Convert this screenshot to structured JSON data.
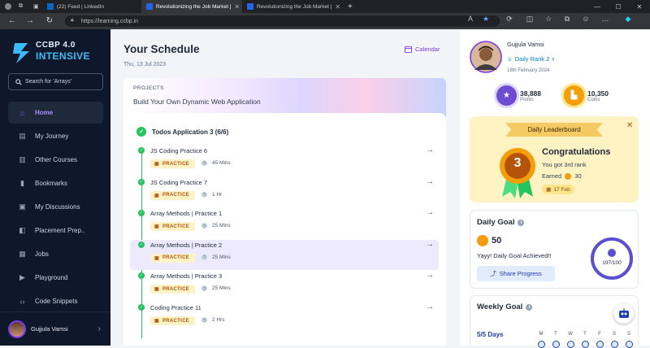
{
  "browser": {
    "tabs": [
      {
        "title": "(22) Feed | LinkedIn",
        "favicon_color": "#0a66c2"
      },
      {
        "title": "Revolutionizing the Job Market |",
        "favicon_color": "#2563eb"
      },
      {
        "title": "Revolutionizing the Job Market |",
        "favicon_color": "#2563eb"
      }
    ],
    "url": "https://learning.ccbp.in"
  },
  "sidebar": {
    "logo_line1": "CCBP 4.0",
    "logo_line2": "INTENSIVE",
    "search_placeholder": "Search for 'Arrays'",
    "items": [
      {
        "label": "Home",
        "icon": "home-icon",
        "active": true
      },
      {
        "label": "My Journey",
        "icon": "journey-icon"
      },
      {
        "label": "Other Courses",
        "icon": "book-icon"
      },
      {
        "label": "Bookmarks",
        "icon": "bookmark-icon"
      },
      {
        "label": "My Discussions",
        "icon": "discussion-icon"
      },
      {
        "label": "Placement Prep..",
        "icon": "placement-icon"
      },
      {
        "label": "Jobs",
        "icon": "briefcase-icon"
      },
      {
        "label": "Playground",
        "icon": "terminal-icon"
      },
      {
        "label": "Code Snippets",
        "icon": "code-icon"
      }
    ],
    "user_name": "Gujjula Vamsi"
  },
  "schedule": {
    "title": "Your Schedule",
    "date": "Thu, 13 Jul 2023",
    "calendar_label": "Calendar",
    "project_label": "PROJECTS",
    "project_title": "Build Your Own Dynamic Web Application",
    "todo_heading": "Todos Application 3 (6/6)",
    "badge_label": "PRACTICE",
    "tasks": [
      {
        "name": "JS Coding Practice 6",
        "duration": "45 Mins",
        "highlighted": false
      },
      {
        "name": "JS Coding Practice 7",
        "duration": "1 Hr",
        "highlighted": false
      },
      {
        "name": "Array Methods | Practice 1",
        "duration": "25 Mins",
        "highlighted": false
      },
      {
        "name": "Array Methods | Practice 2",
        "duration": "25 Mins",
        "highlighted": true
      },
      {
        "name": "Array Methods | Practice 3",
        "duration": "25 Mins",
        "highlighted": false
      },
      {
        "name": "Coding Practice 11",
        "duration": "2 Hrs",
        "highlighted": false
      }
    ]
  },
  "profile": {
    "name": "Gujjula Vamsi",
    "rank": "Daily Rank 2",
    "date": "18th February 2024",
    "points_value": "38,888",
    "points_label": "Points",
    "coins_value": "10,350",
    "coins_label": "Coins"
  },
  "leaderboard": {
    "title": "Daily Leaderboard",
    "medal_number": "3",
    "congrats": "Congratulations",
    "rank_text": "You got 3rd rank",
    "earned_label": "Earned",
    "earned_value": "30",
    "date_badge": "17 Feb"
  },
  "daily_goal": {
    "title": "Daily Goal",
    "value": "50",
    "message": "Yayy! Daily Goal Achieved!!",
    "share_label": "Share Progress",
    "progress_text": "197/100",
    "progress_fraction": 1.0,
    "ring_color": "#5b4fd6"
  },
  "weekly_goal": {
    "title": "Weekly Goal",
    "days_text": "5/5 Days",
    "day_letters": [
      "M",
      "T",
      "W",
      "T",
      "F",
      "S",
      "S"
    ]
  },
  "colors": {
    "sidebar_bg": "#0f172a",
    "accent": "#7c3aed",
    "success": "#22c55e",
    "practice_badge": "#fef3c7"
  }
}
